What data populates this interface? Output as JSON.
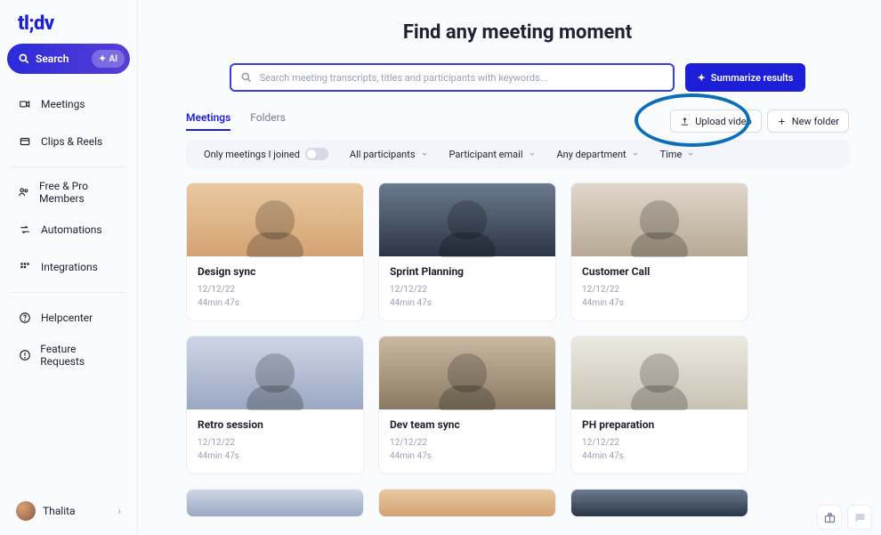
{
  "brand": "tl;dv",
  "search_pill": {
    "label": "Search",
    "chip": "AI"
  },
  "nav": {
    "meetings": "Meetings",
    "clips": "Clips & Reels",
    "members": "Free & Pro Members",
    "automations": "Automations",
    "integrations": "Integrations",
    "helpcenter": "Helpcenter",
    "feature_requests": "Feature Requests"
  },
  "user": {
    "name": "Thalita"
  },
  "page_title": "Find any meeting moment",
  "searchbox": {
    "placeholder": "Search meeting transcripts, titles and participants with keywords..."
  },
  "summarize": "Summarize results",
  "tabs": {
    "meetings": "Meetings",
    "folders": "Folders"
  },
  "actions": {
    "upload": "Upload video",
    "new_folder": "New folder"
  },
  "filters": {
    "only_joined": "Only meetings I joined",
    "all_participants": "All participants",
    "participant_email": "Participant email",
    "department": "Any department",
    "time": "Time"
  },
  "cards": [
    {
      "title": "Design sync",
      "date": "12/12/22",
      "dur": "44min 47s"
    },
    {
      "title": "Sprint Planning",
      "date": "12/12/22",
      "dur": "44min 47s"
    },
    {
      "title": "Customer Call",
      "date": "12/12/22",
      "dur": "44min 47s"
    },
    {
      "title": "Retro session",
      "date": "12/12/22",
      "dur": "44min 47s"
    },
    {
      "title": "Dev team sync",
      "date": "12/12/22",
      "dur": "44min 47s"
    },
    {
      "title": "PH preparation",
      "date": "12/12/22",
      "dur": "44min 47s"
    }
  ]
}
